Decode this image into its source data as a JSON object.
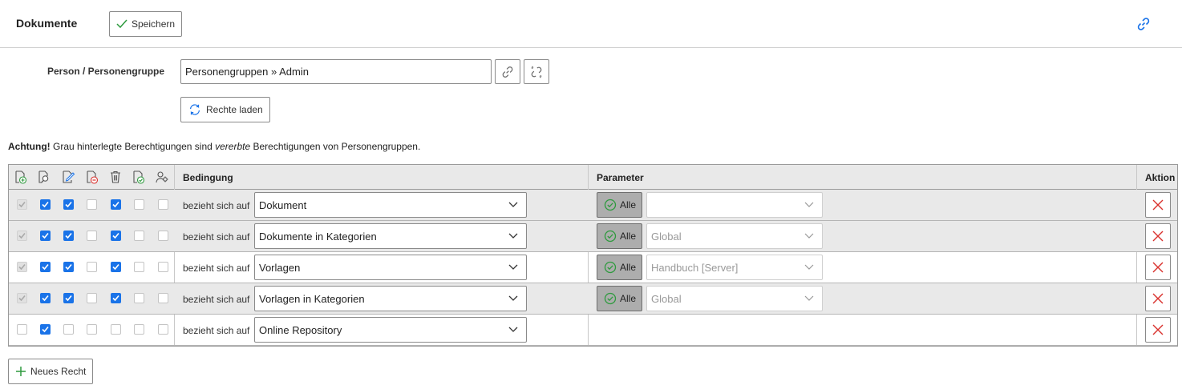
{
  "header": {
    "title": "Dokumente",
    "save_label": "Speichern"
  },
  "person": {
    "label": "Person / Personengruppe",
    "value": "Personengruppen » Admin",
    "reload_label": "Rechte laden"
  },
  "notice": {
    "strong": "Achtung!",
    "text1": " Grau hinterlegte Berechtigungen sind ",
    "emph": "vererbte",
    "text2": " Berechtigungen von Personengruppen."
  },
  "table": {
    "permission_icons": [
      "create-icon",
      "read-icon",
      "edit-icon",
      "remove-icon",
      "delete-icon",
      "approve-icon",
      "admin-icon"
    ],
    "col_condition": "Bedingung",
    "col_parameter": "Parameter",
    "col_action": "Aktion",
    "condition_prefix": "bezieht sich auf",
    "alle_label": "Alle",
    "rows": [
      {
        "inherited": true,
        "perms": [
          "inherit",
          "on",
          "on",
          "off",
          "on",
          "off",
          "off"
        ],
        "target": "Dokument",
        "has_param": true,
        "param": ""
      },
      {
        "inherited": true,
        "perms": [
          "inherit",
          "on",
          "on",
          "off",
          "on",
          "off",
          "off"
        ],
        "target": "Dokumente in Kategorien",
        "has_param": true,
        "param": "Global"
      },
      {
        "inherited": false,
        "perms": [
          "inherit",
          "on",
          "on",
          "off",
          "on",
          "off",
          "off"
        ],
        "target": "Vorlagen",
        "has_param": true,
        "param": "Handbuch [Server]"
      },
      {
        "inherited": true,
        "perms": [
          "inherit",
          "on",
          "on",
          "off",
          "on",
          "off",
          "off"
        ],
        "target": "Vorlagen in Kategorien",
        "has_param": true,
        "param": "Global"
      },
      {
        "inherited": false,
        "perms": [
          "off",
          "on",
          "off",
          "off",
          "off",
          "off",
          "off"
        ],
        "target": "Online Repository",
        "has_param": false,
        "param": ""
      }
    ]
  },
  "footer": {
    "new_label": "Neues Recht"
  },
  "colors": {
    "accent": "#1a73e8",
    "inherited_row": "#e9e9e9",
    "delete_red": "#d9302c",
    "ok_green": "#2e9a3e"
  }
}
